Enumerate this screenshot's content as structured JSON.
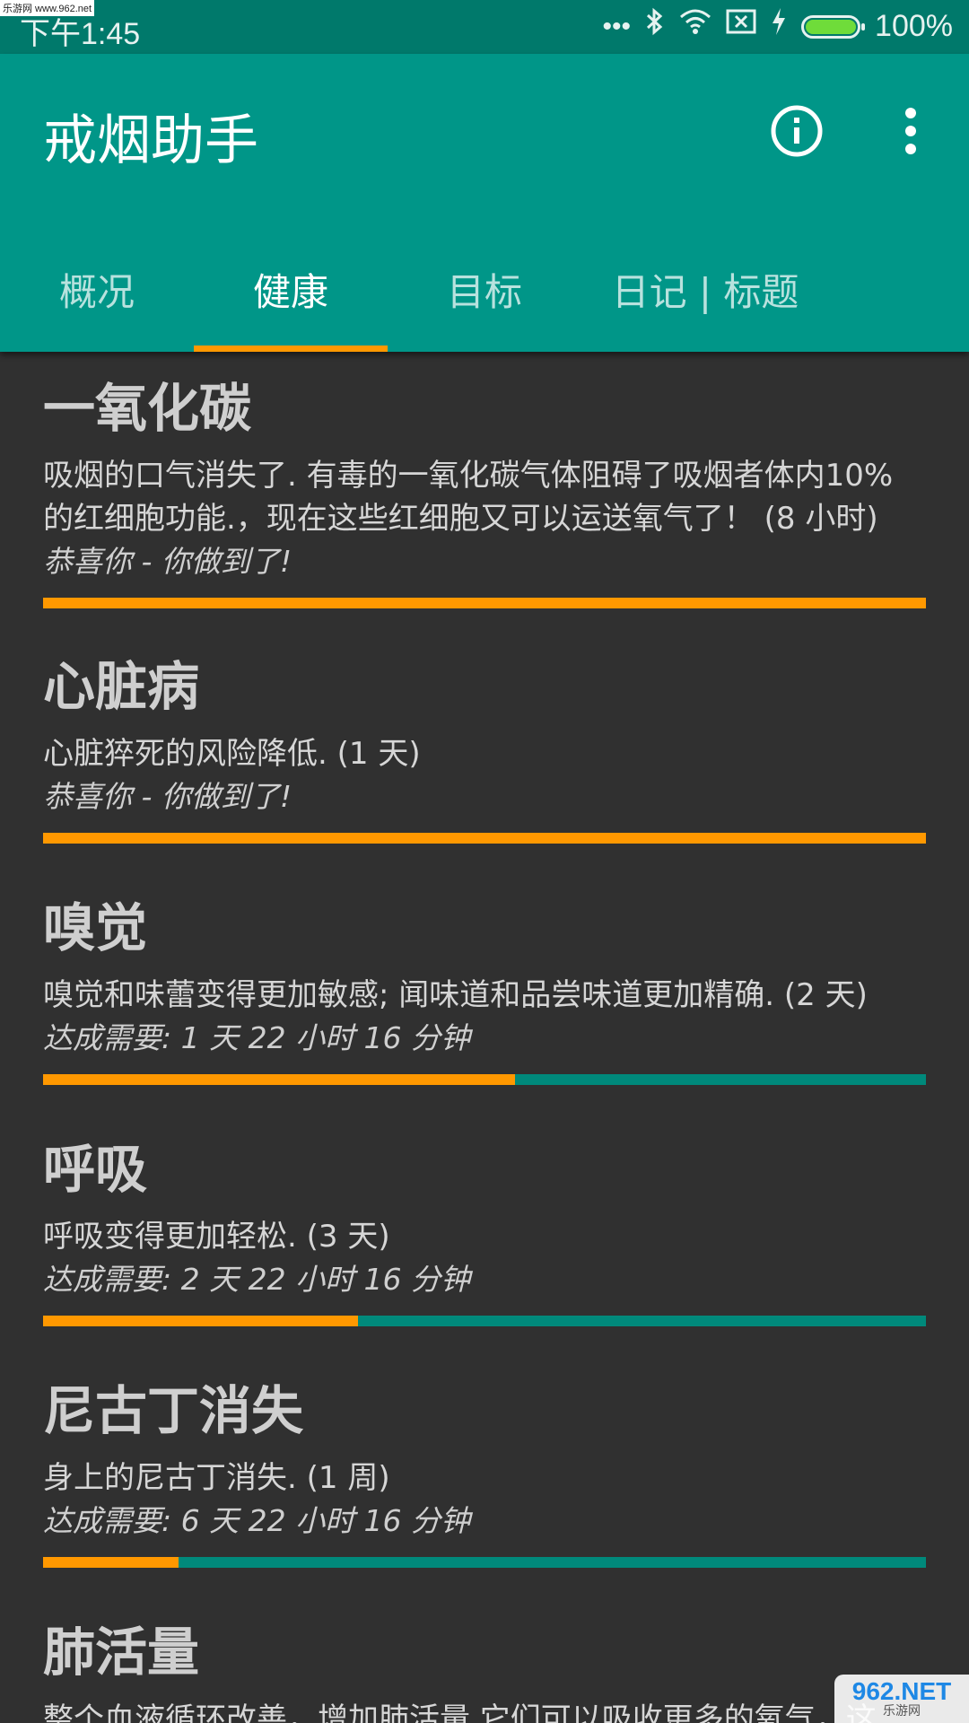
{
  "status_bar": {
    "time": "下午1:45",
    "dots": "•••",
    "battery_percent": "100%",
    "battery_level": 1.0
  },
  "watermark": {
    "top_left": "乐游网 www.962.net",
    "bottom_right_logo": "962.NET",
    "bottom_right_sub": "乐游网"
  },
  "app_bar": {
    "title": "戒烟助手",
    "info_icon": "info-circle-icon",
    "more_icon": "more-vert-icon"
  },
  "tabs": [
    {
      "label": "概况",
      "active": false
    },
    {
      "label": "健康",
      "active": true
    },
    {
      "label": "目标",
      "active": false
    },
    {
      "label": "日记 | 标题",
      "active": false
    }
  ],
  "colors": {
    "primary": "#009688",
    "primary_dark": "#00796b",
    "accent": "#ff9800",
    "background": "#303030"
  },
  "health_items": [
    {
      "title": "一氧化碳",
      "desc_line1": "吸烟的口气消失了. 有毒的一氧化碳气体阻碍了吸烟者体内10%",
      "desc_line2": "的红细胞功能.，现在这些红细胞又可以运送氧气了！ (8 小时)",
      "status": "恭喜你 - 你做到了!",
      "progress": 1.0
    },
    {
      "title": "心脏病",
      "desc_line1": "心脏猝死的风险降低. (1 天)",
      "status": "恭喜你 - 你做到了!",
      "progress": 1.0
    },
    {
      "title": "嗅觉",
      "desc_line1": "嗅觉和味蕾变得更加敏感; 闻味道和品尝味道更加精确. (2 天)",
      "status": "达成需要: 1 天 22 小时 16 分钟",
      "progress": 0.535
    },
    {
      "title": "呼吸",
      "desc_line1": "呼吸变得更加轻松. (3 天)",
      "status": "达成需要: 2 天 22 小时 16 分钟",
      "progress": 0.357
    },
    {
      "title": "尼古丁消失",
      "desc_line1": "身上的尼古丁消失. (1 周)",
      "status": "达成需要: 6 天 22 小时 16 分钟",
      "progress": 0.153
    },
    {
      "title": "肺活量",
      "desc_line1": "整个血液循环改善，增加肺活量.它们可以吸收更多的氧气，这"
    }
  ]
}
